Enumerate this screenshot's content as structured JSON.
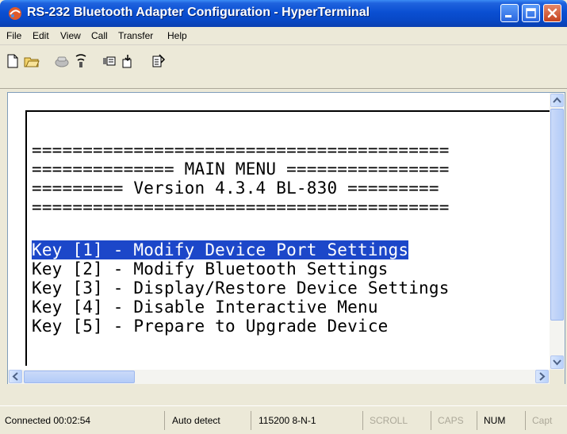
{
  "window": {
    "title": "RS-232 Bluetooth Adapter Configuration - HyperTerminal",
    "app_icon": "hyperterminal-icon",
    "controls": [
      "minimize-icon",
      "maximize-icon",
      "close-icon"
    ]
  },
  "menu": {
    "items": [
      "File",
      "Edit",
      "View",
      "Call",
      "Transfer",
      "Help"
    ]
  },
  "toolbar": {
    "icons": [
      "new-icon",
      "open-icon",
      "disconnect-icon",
      "dial-icon",
      "send-icon",
      "receive-icon",
      "properties-icon"
    ]
  },
  "terminal": {
    "lines": [
      "=========================================",
      "============== MAIN MENU ================",
      "========= Version 4.3.4 BL-830 =========",
      "========================================="
    ],
    "menu_options": [
      {
        "text": "Key [1] - Modify Device Port Settings",
        "selected": true
      },
      {
        "text": "Key [2] - Modify Bluetooth Settings",
        "selected": false
      },
      {
        "text": "Key [3] - Display/Restore Device Settings",
        "selected": false
      },
      {
        "text": "Key [4] - Disable Interactive Menu",
        "selected": false
      },
      {
        "text": "Key [5] - Prepare to Upgrade Device",
        "selected": false
      }
    ]
  },
  "statusbar": {
    "connected": "Connected 00:02:54",
    "detect": "Auto detect",
    "settings": "115200 8-N-1",
    "scroll": "SCROLL",
    "caps": "CAPS",
    "num": "NUM",
    "capture": "Capt"
  },
  "colors": {
    "titlebar": "#0A4FD2",
    "selection": "#1C47C9",
    "chrome": "#ECE9D8"
  }
}
